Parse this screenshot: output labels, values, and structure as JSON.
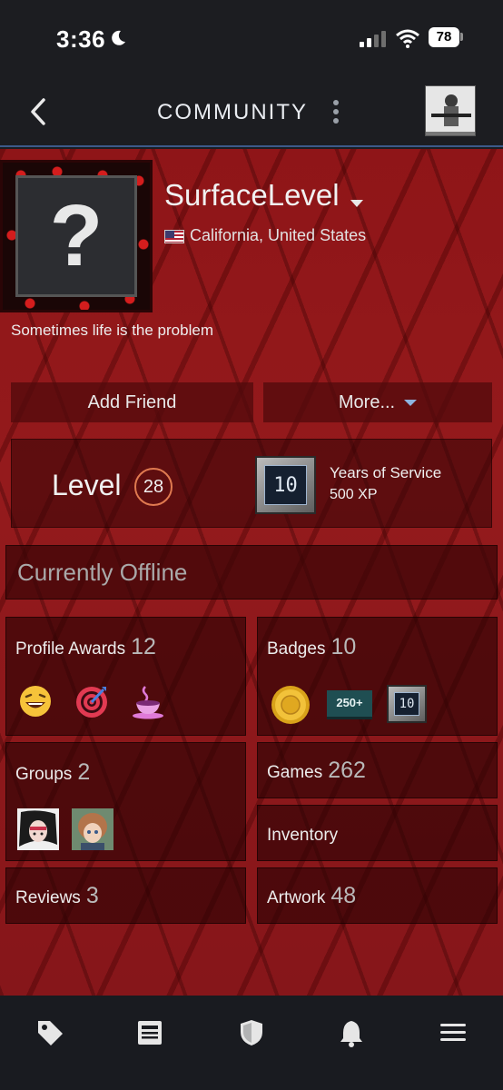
{
  "status_bar": {
    "time": "3:36",
    "battery": "78"
  },
  "header": {
    "title": "COMMUNITY"
  },
  "profile": {
    "avatar_glyph": "?",
    "username": "SurfaceLevel",
    "location": "California, United States",
    "summary": "Sometimes life is the problem"
  },
  "actions": {
    "add_friend": "Add Friend",
    "more": "More..."
  },
  "level": {
    "label": "Level",
    "value": "28",
    "badge_number": "10",
    "badge_title": "Years of Service",
    "badge_xp": "500 XP"
  },
  "status": {
    "text": "Currently Offline"
  },
  "sections": {
    "profile_awards": {
      "label": "Profile Awards",
      "count": "12",
      "icons": [
        "laughing-emoji-icon",
        "target-icon",
        "hot-drink-icon"
      ]
    },
    "badges": {
      "label": "Badges",
      "count": "10",
      "icons": [
        "gold-coin-badge-icon",
        "250-plus-badge-icon",
        "years-of-service-badge-icon"
      ],
      "badge_250_text": "250+",
      "badge_yos_text": "10"
    },
    "groups": {
      "label": "Groups",
      "count": "2"
    },
    "games": {
      "label": "Games",
      "count": "262"
    },
    "inventory": {
      "label": "Inventory"
    },
    "reviews": {
      "label": "Reviews",
      "count": "3"
    },
    "artwork": {
      "label": "Artwork",
      "count": "48"
    }
  },
  "nav": {
    "icons": [
      "tag-icon",
      "news-icon",
      "shield-icon",
      "bell-icon",
      "menu-icon"
    ]
  },
  "colors": {
    "accent_blue": "#3c5a8a",
    "profile_red": "#8f1518",
    "level_ring": "#e07a50"
  }
}
